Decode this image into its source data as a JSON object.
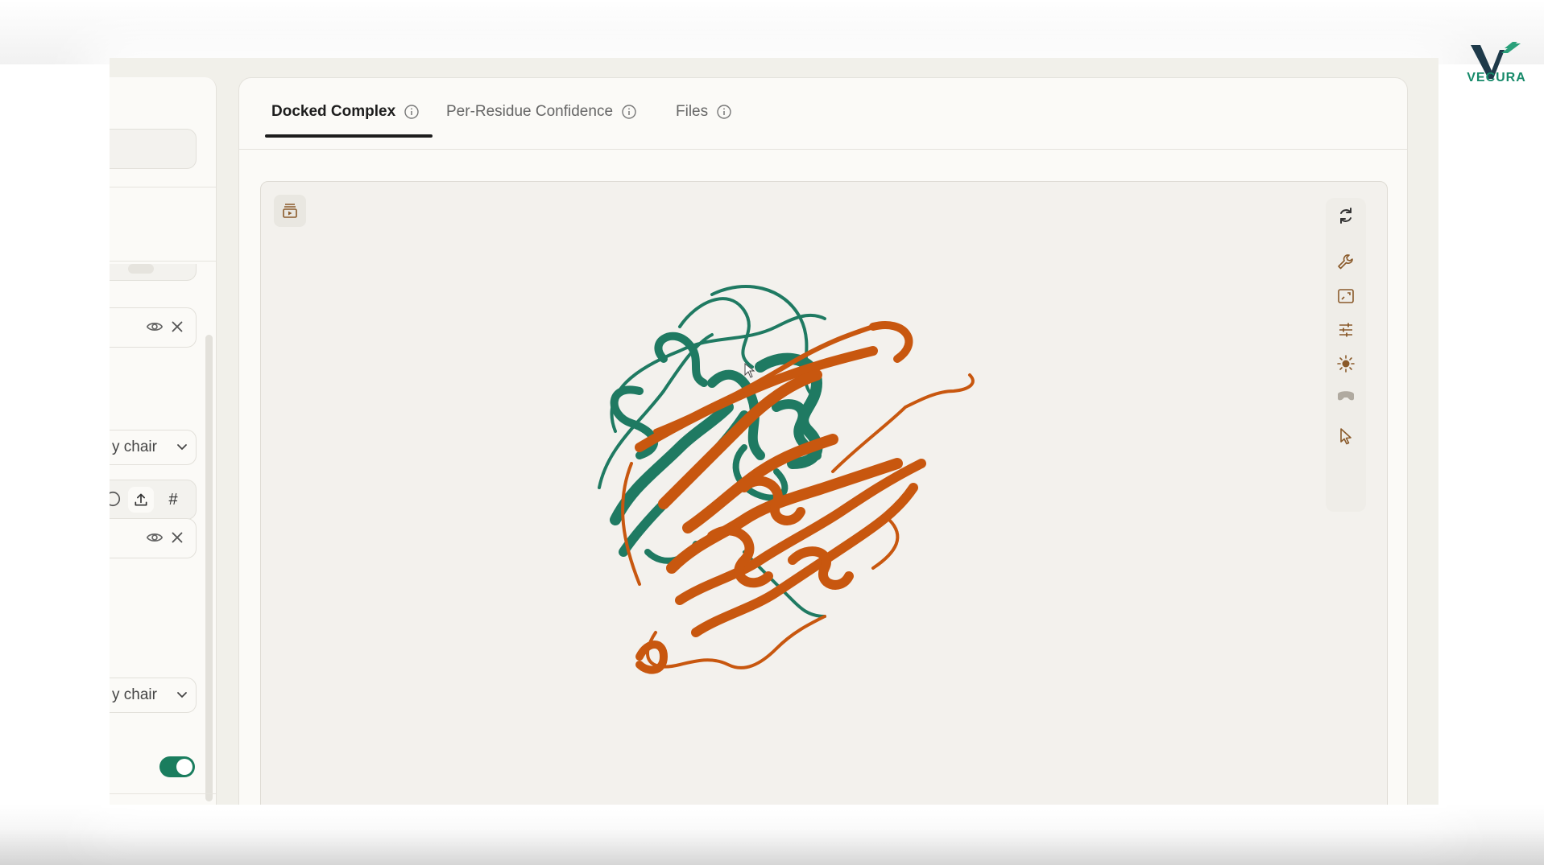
{
  "brand": {
    "name": "VECURA",
    "accent": "#178a6a",
    "dark": "#1e3a4a"
  },
  "left_panel": {
    "select_1_value": "y chair",
    "select_2_value": "y chair",
    "eye_icon": "eye-icon",
    "close_icon": "close-icon",
    "upload_icon": "upload-icon",
    "hash_symbol": "#",
    "toggle_on": true
  },
  "tabs": [
    {
      "label": "Docked Complex",
      "active": true
    },
    {
      "label": "Per-Residue Confidence",
      "active": false
    },
    {
      "label": "Files",
      "active": false
    }
  ],
  "viewer": {
    "toolbar_icons": [
      "refresh-icon",
      "wrench-icon",
      "fullscreen-icon",
      "sliders-icon",
      "brightness-icon",
      "vr-headset-icon",
      "cursor-select-icon"
    ],
    "snapshot_icon": "animation-icon",
    "chain_colors": {
      "chain_a": "#1f7a62",
      "chain_b": "#c8570f"
    }
  }
}
